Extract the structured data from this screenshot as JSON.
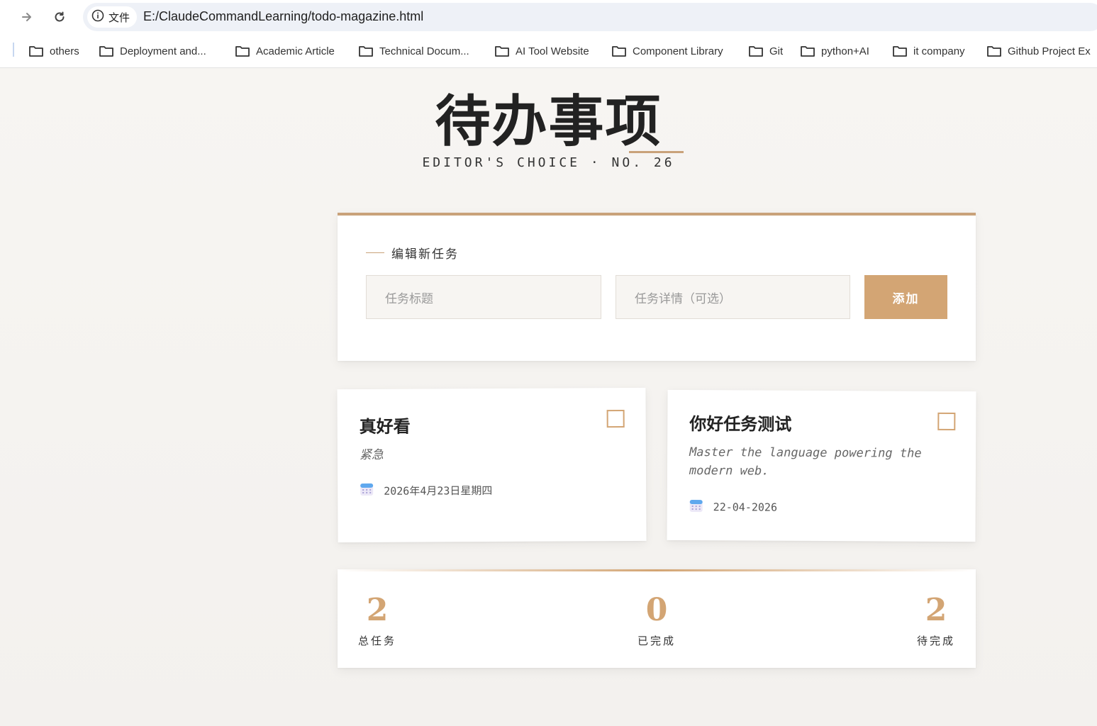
{
  "browser": {
    "site_info_label": "文件",
    "url": "E:/ClaudeCommandLearning/todo-magazine.html",
    "bookmarks": [
      "others",
      "Deployment and...",
      "Academic Article",
      "Technical Docum...",
      "AI Tool Website",
      "Component Library",
      "Git",
      "python+AI",
      "it company",
      "Github Project Ex"
    ]
  },
  "header": {
    "title": "待办事项",
    "subtitle": "EDITOR'S CHOICE · NO. 26"
  },
  "form": {
    "label": "编辑新任务",
    "title_placeholder": "任务标题",
    "detail_placeholder": "任务详情（可选）",
    "add_label": "添加"
  },
  "tasks": [
    {
      "title": "真好看",
      "description": "紧急",
      "date": "2026年4月23日星期四",
      "completed": false
    },
    {
      "title": "你好任务测试",
      "description": "Master the language powering the modern web.",
      "date": "22-04-2026",
      "completed": false
    }
  ],
  "stats": [
    {
      "value": "2",
      "label": "总任务"
    },
    {
      "value": "0",
      "label": "已完成"
    },
    {
      "value": "2",
      "label": "待完成"
    }
  ],
  "colors": {
    "accent": "#d3a574",
    "background": "#f6f4f1",
    "card": "#ffffff"
  }
}
